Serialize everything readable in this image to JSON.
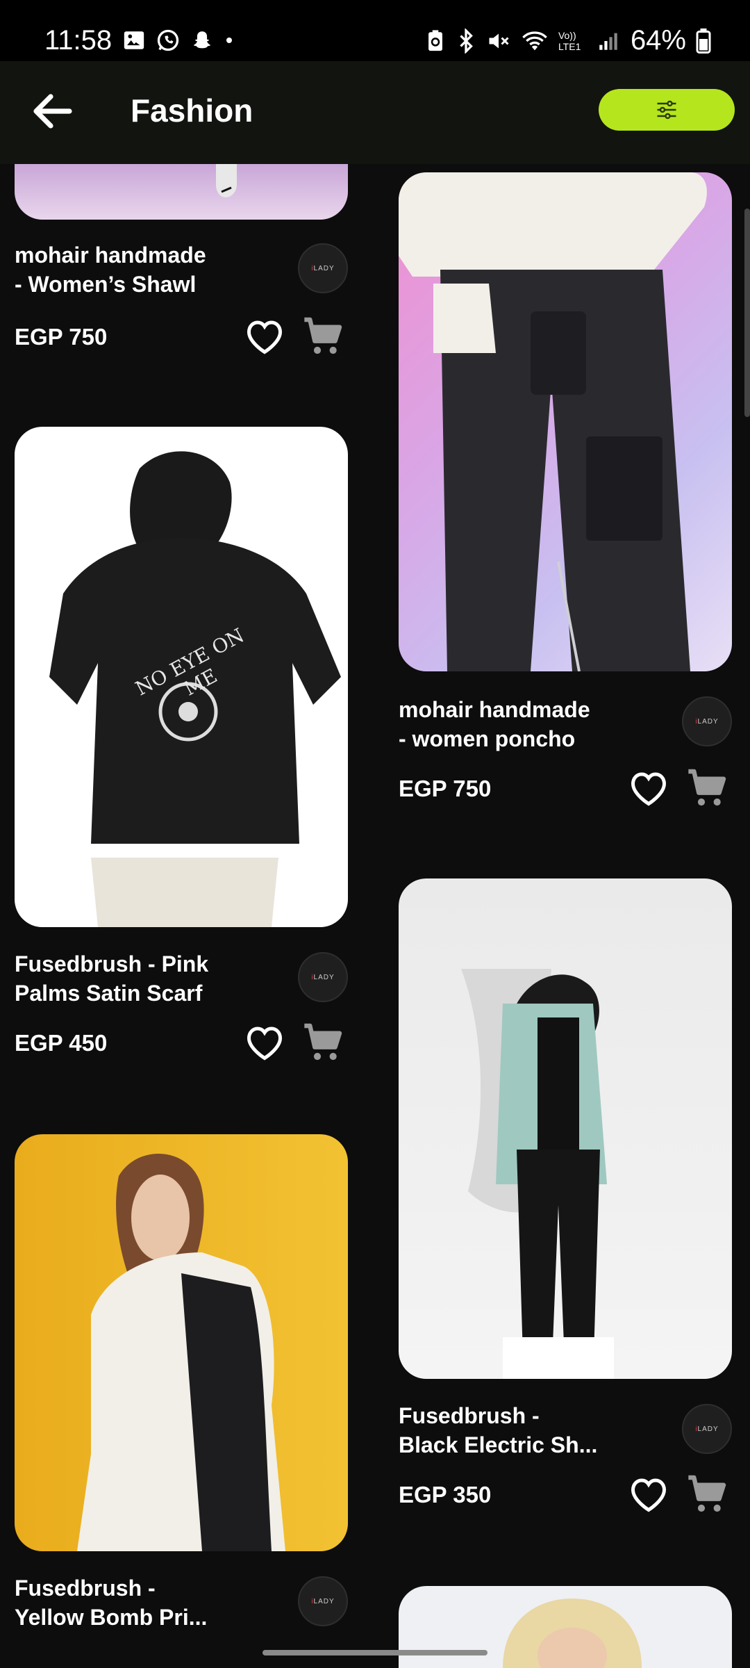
{
  "status_bar": {
    "time": "11:58",
    "battery": "64%",
    "network": "Vo)) LTE1"
  },
  "app_bar": {
    "title": "Fashion",
    "back_icon": "arrow-left-icon",
    "filter_icon": "sliders-icon"
  },
  "colors": {
    "accent": "#b5e61d",
    "background": "#0d0d0d",
    "appbar": "#121410"
  },
  "products": [
    {
      "name": "mohair handmade\n- Women’s Shawl",
      "price": "EGP 750",
      "shop_badge": "LADY"
    },
    {
      "name": "mohair handmade\n- women poncho",
      "price": "EGP 750",
      "shop_badge": "LADY"
    },
    {
      "name": "Fusedbrush  - Pink\nPalms Satin Scarf",
      "price": "EGP 450",
      "shop_badge": "LADY"
    },
    {
      "name": "Fusedbrush  -\nBlack Electric Sh...",
      "price": "EGP 350",
      "shop_badge": "LADY"
    },
    {
      "name": "Fusedbrush  -\nYellow Bomb Pri...",
      "price": "",
      "shop_badge": "LADY"
    }
  ],
  "artwork": {
    "sweatshirt_print": "NO EYE ON ME"
  }
}
